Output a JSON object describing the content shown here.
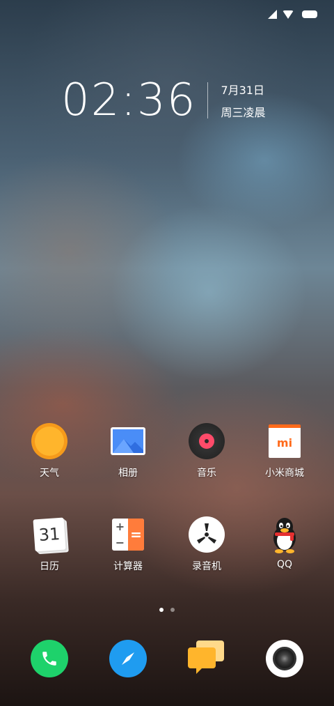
{
  "status_bar": {
    "icons": [
      "signal-icon",
      "wifi-icon",
      "battery-icon"
    ]
  },
  "clock": {
    "time": "02:36",
    "date": "7月31日",
    "weekday": "周三凌晨"
  },
  "apps": [
    {
      "name": "weather",
      "label": "天气",
      "icon": "sun-icon"
    },
    {
      "name": "gallery",
      "label": "相册",
      "icon": "gallery-icon"
    },
    {
      "name": "music",
      "label": "音乐",
      "icon": "music-disc-icon"
    },
    {
      "name": "mi-store",
      "label": "小米商城",
      "icon": "mi-store-icon"
    },
    {
      "name": "calendar",
      "label": "日历",
      "icon": "calendar-icon",
      "day": "31"
    },
    {
      "name": "calculator",
      "label": "计算器",
      "icon": "calculator-icon"
    },
    {
      "name": "recorder",
      "label": "录音机",
      "icon": "recorder-icon"
    },
    {
      "name": "qq",
      "label": "QQ",
      "icon": "qq-penguin-icon"
    }
  ],
  "page_indicator": {
    "pages": 2,
    "active": 0
  },
  "dock": [
    {
      "name": "phone",
      "icon": "phone-icon",
      "color": "#1ed26b"
    },
    {
      "name": "browser",
      "icon": "compass-icon",
      "color": "#1f9cf0"
    },
    {
      "name": "messages",
      "icon": "message-icon",
      "color": "#ffb52c"
    },
    {
      "name": "camera",
      "icon": "camera-icon",
      "color": "#ffffff"
    }
  ]
}
